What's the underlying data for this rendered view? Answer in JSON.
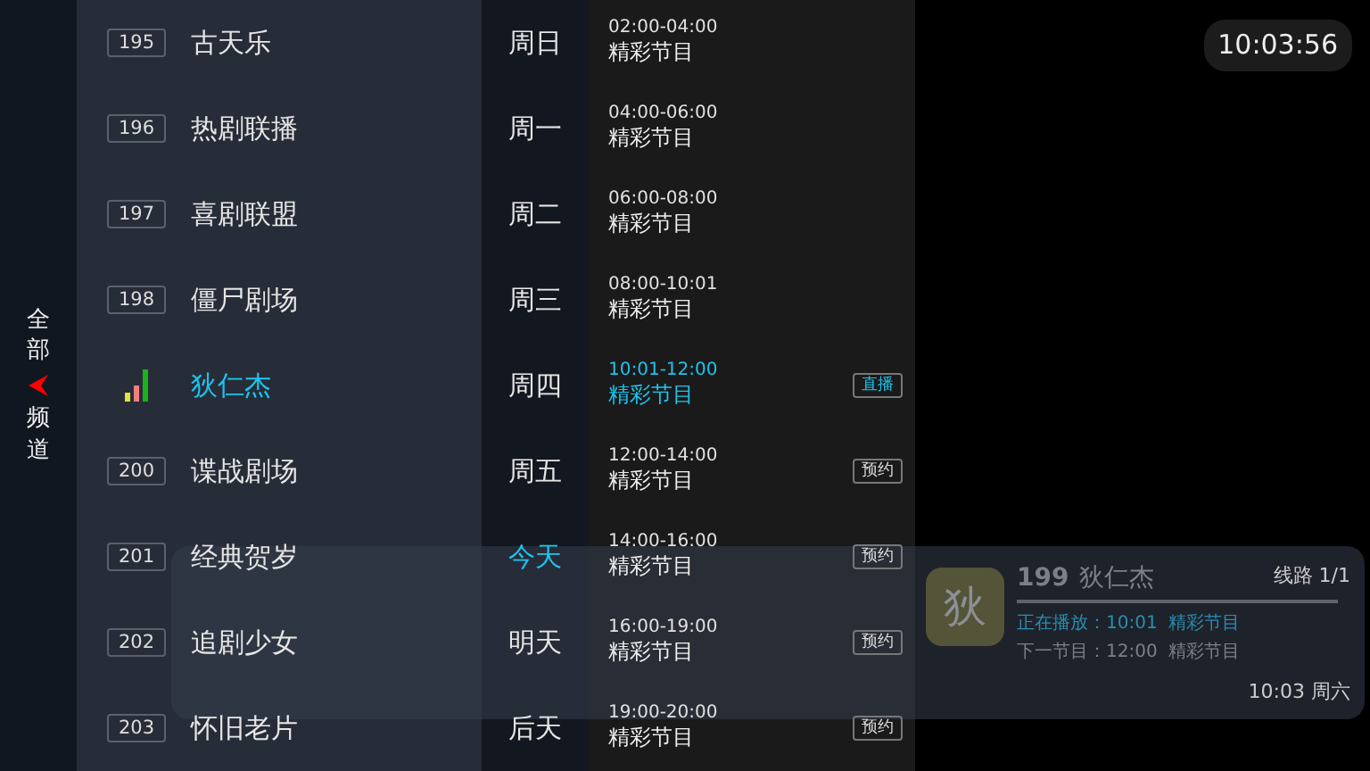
{
  "sidebar": {
    "label_top": "全部",
    "label_bottom": "频道"
  },
  "channels": [
    {
      "number": "195",
      "name": "古天乐",
      "playing": false
    },
    {
      "number": "196",
      "name": "热剧联播",
      "playing": false
    },
    {
      "number": "197",
      "name": "喜剧联盟",
      "playing": false
    },
    {
      "number": "198",
      "name": "僵尸剧场",
      "playing": false
    },
    {
      "name": "狄仁杰",
      "playing": true
    },
    {
      "number": "200",
      "name": "谍战剧场",
      "playing": false
    },
    {
      "number": "201",
      "name": "经典贺岁",
      "playing": false
    },
    {
      "number": "202",
      "name": "追剧少女",
      "playing": false
    },
    {
      "number": "203",
      "name": "怀旧老片",
      "playing": false
    }
  ],
  "days": [
    {
      "label": "周日",
      "selected": false
    },
    {
      "label": "周一",
      "selected": false
    },
    {
      "label": "周二",
      "selected": false
    },
    {
      "label": "周三",
      "selected": false
    },
    {
      "label": "周四",
      "selected": false
    },
    {
      "label": "周五",
      "selected": false
    },
    {
      "label": "今天",
      "selected": true
    },
    {
      "label": "明天",
      "selected": false
    },
    {
      "label": "后天",
      "selected": false
    }
  ],
  "programs": [
    {
      "time": "02:00-04:00",
      "title": "精彩节目",
      "kind": "past"
    },
    {
      "time": "04:00-06:00",
      "title": "精彩节目",
      "kind": "past"
    },
    {
      "time": "06:00-08:00",
      "title": "精彩节目",
      "kind": "past"
    },
    {
      "time": "08:00-10:01",
      "title": "精彩节目",
      "kind": "past"
    },
    {
      "time": "10:01-12:00",
      "title": "精彩节目",
      "kind": "live",
      "badge": "直播"
    },
    {
      "time": "12:00-14:00",
      "title": "精彩节目",
      "kind": "upcoming",
      "badge": "预约"
    },
    {
      "time": "14:00-16:00",
      "title": "精彩节目",
      "kind": "upcoming",
      "badge": "预约"
    },
    {
      "time": "16:00-19:00",
      "title": "精彩节目",
      "kind": "upcoming",
      "badge": "预约"
    },
    {
      "time": "19:00-20:00",
      "title": "精彩节目",
      "kind": "upcoming",
      "badge": "预约"
    }
  ],
  "clock": "10:03:56",
  "info_panel": {
    "logo_char": "狄",
    "number": "199",
    "name": "狄仁杰",
    "now_playing": "正在播放：10:01  精彩节目",
    "next": "下一节目：12:00  精彩节目",
    "line": "线路 1/1",
    "datetime": "10:03 周六"
  }
}
